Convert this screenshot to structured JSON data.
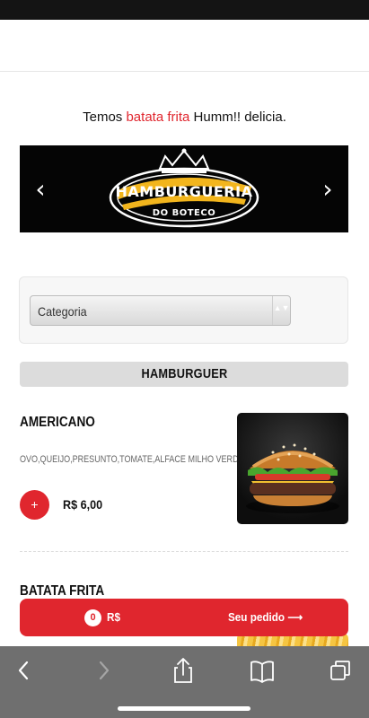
{
  "promo": {
    "before": "Temos ",
    "highlight": "batata frita",
    "after": " Humm!! delicia."
  },
  "banner": {
    "logo_title": "HAMBURGUERIA",
    "logo_subtitle": "DO BOTECO",
    "prev_icon": "chevron-left-icon",
    "next_icon": "chevron-right-icon"
  },
  "filter": {
    "category_selected": "Categoria"
  },
  "section": {
    "title": "HAMBURGUER"
  },
  "products": [
    {
      "name": "AMERICANO",
      "description": "OVO,QUEIJO,PRESUNTO,TOMATE,ALFACE MILHO VERDE",
      "price": "R$ 6,00",
      "add_label": "+"
    },
    {
      "name": "BATATA FRITA"
    }
  ],
  "order_bar": {
    "item_count": "0",
    "total_label": "R$",
    "cta_label": "Seu pedido",
    "cta_icon": "arrow-right-icon"
  },
  "browser_toolbar": {
    "icons": [
      "back-icon",
      "forward-icon",
      "share-icon",
      "bookmarks-icon",
      "tabs-icon"
    ]
  },
  "colors": {
    "accent": "#e0262e",
    "banner_bg": "#050505",
    "logo_stripe": "#f2b51d",
    "browser_bar": "#6f6f6f"
  }
}
